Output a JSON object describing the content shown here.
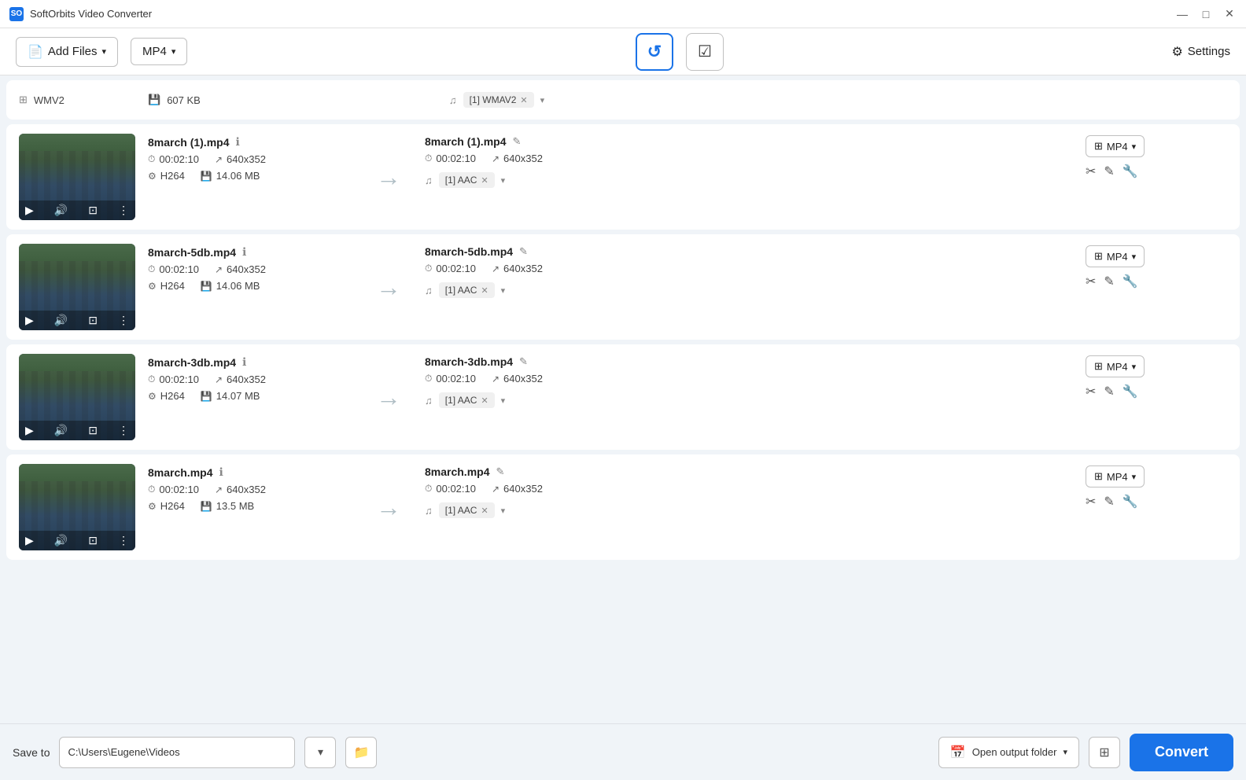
{
  "app": {
    "title": "SoftOrbits Video Converter",
    "icon": "SO"
  },
  "window_controls": {
    "minimize": "—",
    "maximize": "□",
    "close": "✕"
  },
  "toolbar": {
    "add_files_label": "Add Files",
    "format_label": "MP4",
    "refresh_icon": "↺",
    "check_icon": "✓",
    "settings_label": "Settings"
  },
  "partial_row": {
    "format": "WMV2",
    "size": "607 KB",
    "audio": "[1] WMAV2"
  },
  "files": [
    {
      "name": "8march (1).mp4",
      "duration": "00:02:10",
      "resolution": "640x352",
      "codec": "H264",
      "size": "14.06 MB",
      "output_name": "8march (1).mp4",
      "output_duration": "00:02:10",
      "output_resolution": "640x352",
      "audio": "[1] AAC",
      "format": "MP4"
    },
    {
      "name": "8march-5db.mp4",
      "duration": "00:02:10",
      "resolution": "640x352",
      "codec": "H264",
      "size": "14.06 MB",
      "output_name": "8march-5db.mp4",
      "output_duration": "00:02:10",
      "output_resolution": "640x352",
      "audio": "[1] AAC",
      "format": "MP4"
    },
    {
      "name": "8march-3db.mp4",
      "duration": "00:02:10",
      "resolution": "640x352",
      "codec": "H264",
      "size": "14.07 MB",
      "output_name": "8march-3db.mp4",
      "output_duration": "00:02:10",
      "output_resolution": "640x352",
      "audio": "[1] AAC",
      "format": "MP4"
    },
    {
      "name": "8march.mp4",
      "duration": "00:02:10",
      "resolution": "640x352",
      "codec": "H264",
      "size": "13.5 MB",
      "output_name": "8march.mp4",
      "output_duration": "00:02:10",
      "output_resolution": "640x352",
      "audio": "[1] AAC",
      "format": "MP4"
    }
  ],
  "bottom_bar": {
    "save_to_label": "Save to",
    "save_path": "C:\\Users\\Eugene\\Videos",
    "open_output_label": "Open output folder",
    "convert_label": "Convert"
  }
}
